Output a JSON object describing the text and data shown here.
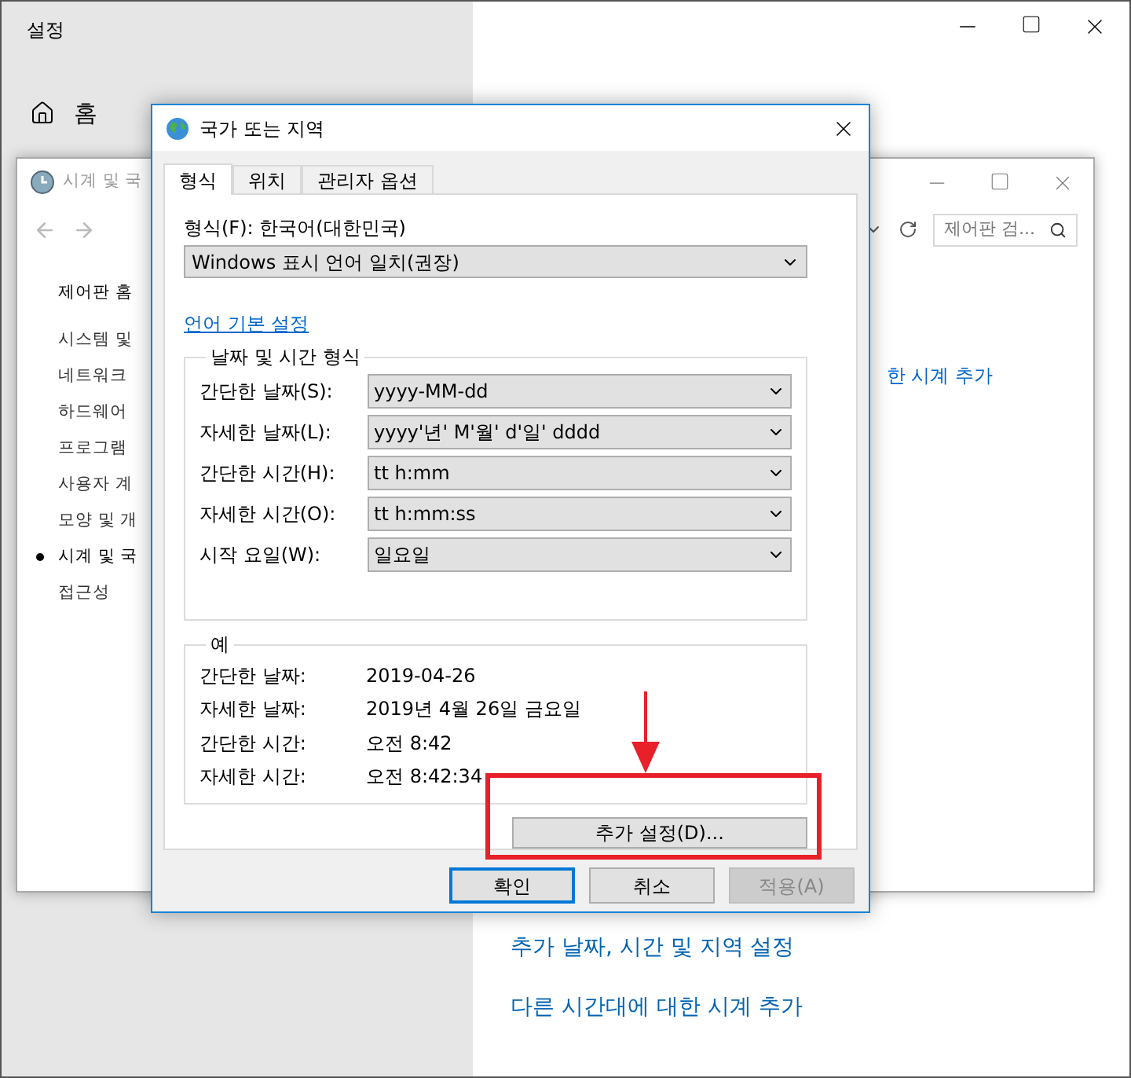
{
  "settings_window": {
    "title": "설정",
    "home": "홈",
    "links": [
      "추가 날짜, 시간 및 지역 설정",
      "다른 시간대에 대한 시계 추가"
    ]
  },
  "control_panel": {
    "title": "시계 및 국",
    "search": {
      "placeholder": "제어판 검..."
    },
    "home_link": "제어판 홈",
    "sidebar": [
      {
        "label": "시스템 및",
        "selected": false
      },
      {
        "label": "네트워크",
        "selected": false
      },
      {
        "label": "하드웨어",
        "selected": false
      },
      {
        "label": "프로그램",
        "selected": false
      },
      {
        "label": "사용자 계",
        "selected": false
      },
      {
        "label": "모양 및 개",
        "selected": false
      },
      {
        "label": "시계 및 국",
        "selected": true
      },
      {
        "label": "접근성",
        "selected": false
      }
    ],
    "link": "한 시계 추가"
  },
  "dialog": {
    "title": "국가 또는 지역",
    "tabs": [
      {
        "label": "형식",
        "selected": true
      },
      {
        "label": "위치",
        "selected": false
      },
      {
        "label": "관리자 옵션",
        "selected": false
      }
    ],
    "format_label": "형식(F): 한국어(대한민국)",
    "format_value": "Windows 표시 언어 일치(권장)",
    "language_link": "언어 기본 설정",
    "format_group": {
      "title": "날짜 및 시간 형식",
      "rows": [
        {
          "label": "간단한 날짜(S):",
          "value": "yyyy-MM-dd"
        },
        {
          "label": "자세한 날짜(L):",
          "value": "yyyy'년' M'월' d'일' dddd"
        },
        {
          "label": "간단한 시간(H):",
          "value": "tt h:mm"
        },
        {
          "label": "자세한 시간(O):",
          "value": "tt h:mm:ss"
        },
        {
          "label": "시작 요일(W):",
          "value": "일요일"
        }
      ]
    },
    "example_group": {
      "title": "예",
      "rows": [
        {
          "label": "간단한 날짜:",
          "value": "2019-04-26"
        },
        {
          "label": "자세한 날짜:",
          "value": "2019년 4월 26일 금요일"
        },
        {
          "label": "간단한 시간:",
          "value": "오전 8:42"
        },
        {
          "label": "자세한 시간:",
          "value": "오전 8:42:34"
        }
      ]
    },
    "additional_button": "추가 설정(D)...",
    "buttons": [
      {
        "label": "확인",
        "default": true,
        "disabled": false
      },
      {
        "label": "취소",
        "default": false,
        "disabled": false
      },
      {
        "label": "적용(A)",
        "default": false,
        "disabled": true
      }
    ]
  }
}
